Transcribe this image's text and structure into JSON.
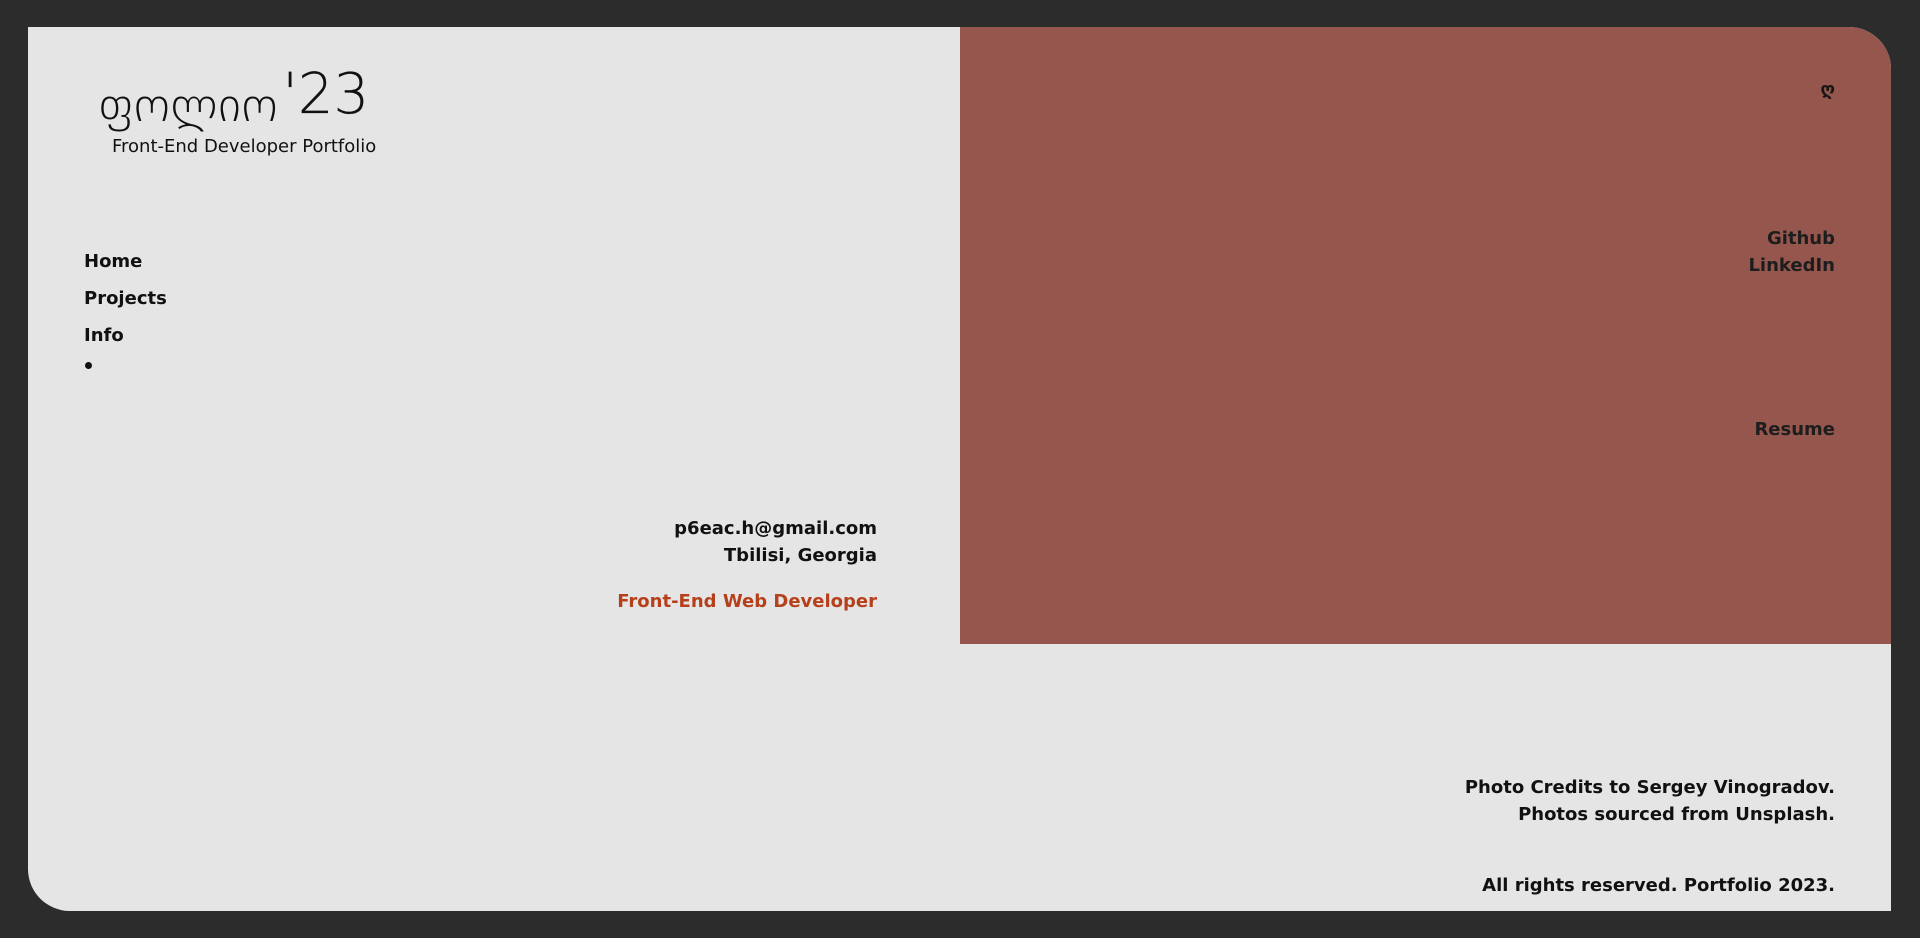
{
  "logo": {
    "text": "ფოლიო",
    "year": "'23"
  },
  "subtitle": "Front-End Developer Portfolio",
  "nav": {
    "items": [
      {
        "label": "Home"
      },
      {
        "label": "Projects"
      },
      {
        "label": "Info"
      }
    ]
  },
  "contact": {
    "email": "p6eac.h@gmail.com",
    "location": "Tbilisi, Georgia",
    "role": "Front-End Web Developer"
  },
  "panel": {
    "language_toggle": "ღ",
    "links": {
      "github": "Github",
      "linkedin": "LinkedIn",
      "resume": "Resume"
    }
  },
  "footer": {
    "credits_line1": "Photo Credits to Sergey Vinogradov.",
    "credits_line2": "Photos sourced from Unsplash.",
    "rights": "All rights reserved. Portfolio 2023."
  },
  "colors": {
    "background": "#e5e5e5",
    "panel": "#95574d",
    "accent": "#b6401c",
    "outer": "#2c2c2c"
  }
}
